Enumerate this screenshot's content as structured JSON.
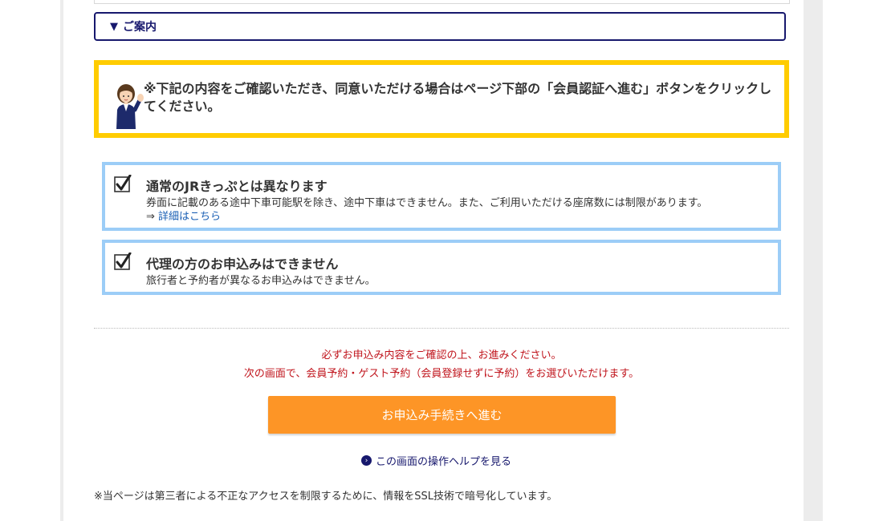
{
  "guide": {
    "toggle_symbol": "▼",
    "label": "ご案内"
  },
  "notice": {
    "text": "※下記の内容をご確認いただき、同意いただける場合はページ下部の「会員認証へ進む」ボタンをクリックしてください。"
  },
  "cards": [
    {
      "checked": true,
      "title": "通常のJRきっぷとは異なります",
      "description": "券面に記載のある途中下車可能駅を除き、途中下車はできません。また、ご利用いただける座席数には制限があります。",
      "link_prefix": "⇒ ",
      "link_text": "詳細はこちら"
    },
    {
      "checked": true,
      "title": "代理の方のお申込みはできません",
      "description": "旅行者と予約者が異なるお申込みはできません。"
    }
  ],
  "warnings": {
    "line1": "必ずお申込み内容をご確認の上、お進みください。",
    "line2": "次の画面で、会員予約・ゲスト予約（会員登録せずに予約）をお選びいただけます。"
  },
  "proceed_button": {
    "label": "お申込み手続きへ進む"
  },
  "help_link": {
    "icon": "chevron-circle-icon",
    "text": "この画面の操作ヘルプを見る"
  },
  "ssl_note": "※当ページは第三者による不正なアクセスを制限するために、情報をSSL技術で暗号化しています。",
  "colors": {
    "navy": "#17186d",
    "notice_border": "#ffcc00",
    "card_border": "#9ccdf7",
    "warning_text": "#c0141c",
    "button_orange": "#fd9526"
  }
}
